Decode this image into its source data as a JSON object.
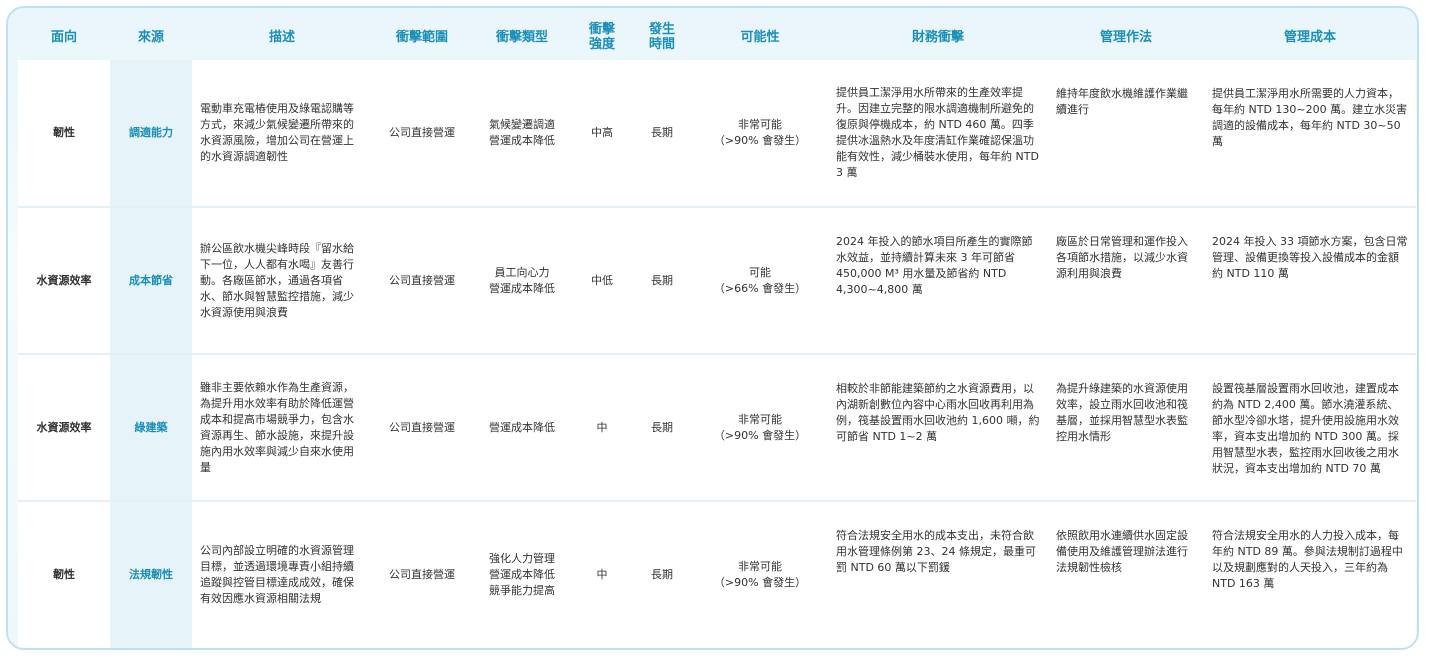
{
  "headers": [
    "面向",
    "來源",
    "描述",
    "衝擊範圍",
    "衝擊類型",
    "衝擊\n強度",
    "發生\n時間",
    "可能性",
    "財務衝擊",
    "管理作法",
    "管理成本"
  ],
  "rows": [
    {
      "facet": "韌性",
      "source": "調適能力",
      "description": "電動車充電樁使用及綠電認購等方式，來減少氣候變遷所帶來的水資源風險，增加公司在營運上的水資源調適韌性",
      "scope": "公司直接營運",
      "type": "氣候變遷調適\n營運成本降低",
      "intensity": "中高",
      "timing": "長期",
      "likelihood": "非常可能\n（>90% 會發生）",
      "financial": "提供員工潔淨用水所帶來的生產效率提升。因建立完整的限水調適機制所避免的復原與停機成本，約 NTD 460 萬。四季提供冰溫熱水及年度清缸作業確認保溫功能有效性，減少桶裝水使用，每年約 NTD 3 萬",
      "practice": "維持年度飲水機維護作業繼續進行",
      "cost": "提供員工潔淨用水所需要的人力資本，每年約 NTD 130~200 萬。建立水災害調適的設備成本，每年約 NTD 30~50 萬"
    },
    {
      "facet": "水資源效率",
      "source": "成本節省",
      "description": "辦公區飲水機尖峰時段『留水給下一位，人人都有水喝』友善行動。各廠區節水，通過各項省水、節水與智慧監控措施，減少水資源使用與浪費",
      "scope": "公司直接營運",
      "type": "員工向心力\n營運成本降低",
      "intensity": "中低",
      "timing": "長期",
      "likelihood": "可能\n（>66% 會發生）",
      "financial": "2024 年投入的節水項目所產生的實際節水效益，並持續計算未來 3 年可節省 450,000 M³ 用水量及節省約 NTD 4,300~4,800 萬",
      "practice": "廠區於日常管理和運作投入各項節水措施，以減少水資源利用與浪費",
      "cost": "2024 年投入 33 項節水方案，包含日常管理、設備更換等投入設備成本的金額約 NTD 110 萬"
    },
    {
      "facet": "水資源效率",
      "source": "綠建築",
      "description": "雖非主要依賴水作為生產資源，為提升用水效率有助於降低運營成本和提高市場競爭力，包含水資源再生、節水設施，來提升設施內用水效率與減少自來水使用量",
      "scope": "公司直接營運",
      "type": "營運成本降低",
      "intensity": "中",
      "timing": "長期",
      "likelihood": "非常可能\n（>90% 會發生）",
      "financial": "相較於非節能建築節約之水資源費用，以內湖新創數位內容中心雨水回收再利用為例，筏基設置雨水回收池約 1,600 噸，約可節省 NTD 1~2 萬",
      "practice": "為提升綠建築的水資源使用效率，設立雨水回收池和筏基層，並採用智慧型水表監控用水情形",
      "cost": "設置筏基層設置雨水回收池，建置成本約為 NTD 2,400 萬。節水澆灌系統、節水型冷卻水塔，提升使用設施用水效率，資本支出增加約 NTD 300 萬。採用智慧型水表，監控雨水回收後之用水狀況，資本支出增加約 NTD 70 萬"
    },
    {
      "facet": "韌性",
      "source": "法規韌性",
      "description": "公司內部設立明確的水資源管理目標，並透過環境專責小組持續追蹤與控管目標達成成效，確保有效因應水資源相關法規",
      "scope": "公司直接營運",
      "type": "強化人力管理\n營運成本降低\n競爭能力提高",
      "intensity": "中",
      "timing": "長期",
      "likelihood": "非常可能\n（>90% 會發生）",
      "financial": "符合法規安全用水的成本支出，未符合飲用水管理條例第 23、24 條規定，最重可罰 NTD 60 萬以下罰鍰",
      "practice": "依照飲用水連續供水固定設備使用及維護管理辦法進行法規韌性檢核",
      "cost": "符合法規安全用水的人力投入成本，每年約 NTD 89 萬。參與法規制訂過程中以及規劃應對的人天投入，三年約為 NTD 163 萬"
    }
  ]
}
